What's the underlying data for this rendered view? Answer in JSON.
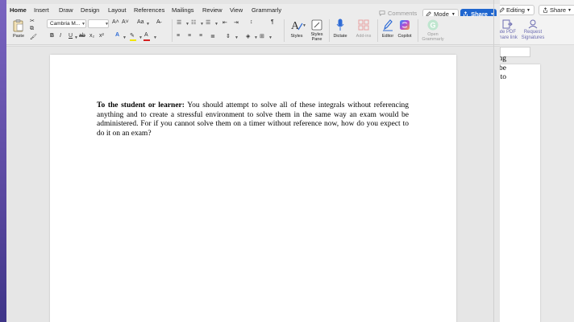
{
  "ribbon_tabs": [
    {
      "label": "Home",
      "active": true
    },
    {
      "label": "Insert"
    },
    {
      "label": "Draw"
    },
    {
      "label": "Design"
    },
    {
      "label": "Layout"
    },
    {
      "label": "References"
    },
    {
      "label": "Mailings"
    },
    {
      "label": "Review"
    },
    {
      "label": "View"
    },
    {
      "label": "Grammarly"
    }
  ],
  "header_buttons": {
    "comments": "Comments",
    "mode": "Mode",
    "share": "Share"
  },
  "ribbon": {
    "paste": "Paste",
    "font_name": "Cambria M...",
    "styles": "Styles",
    "styles_pane": "Styles Pane",
    "dictate": "Dictate",
    "add_ins": "Add-ins",
    "editor": "Editor",
    "copilot": "Copilot",
    "open_grammarly": "Open Grammarly"
  },
  "background_window": {
    "editing": "Editing",
    "share": "Share",
    "create_pdf_line1": "ate PDF",
    "create_pdf_line2": "share link",
    "request_line1": "Request",
    "request_line2": "Signatures",
    "text_fragments": [
      "ng",
      "be",
      "to"
    ]
  },
  "document": {
    "bold_lead": "To the student or learner:",
    "body": " You should attempt to solve all of these integrals without referencing anything and to create a stressful environment to solve them in the same way an exam would be administered. For if you cannot solve them on a timer without reference now, how do you expect to do it on an exam?"
  },
  "colors": {
    "accent": "#1f66cf",
    "tab_underline": "#2e6bd6",
    "font_color_bar": "#d42020",
    "highlight_bar": "#f2e600",
    "desktop": "#6b5aa8"
  }
}
